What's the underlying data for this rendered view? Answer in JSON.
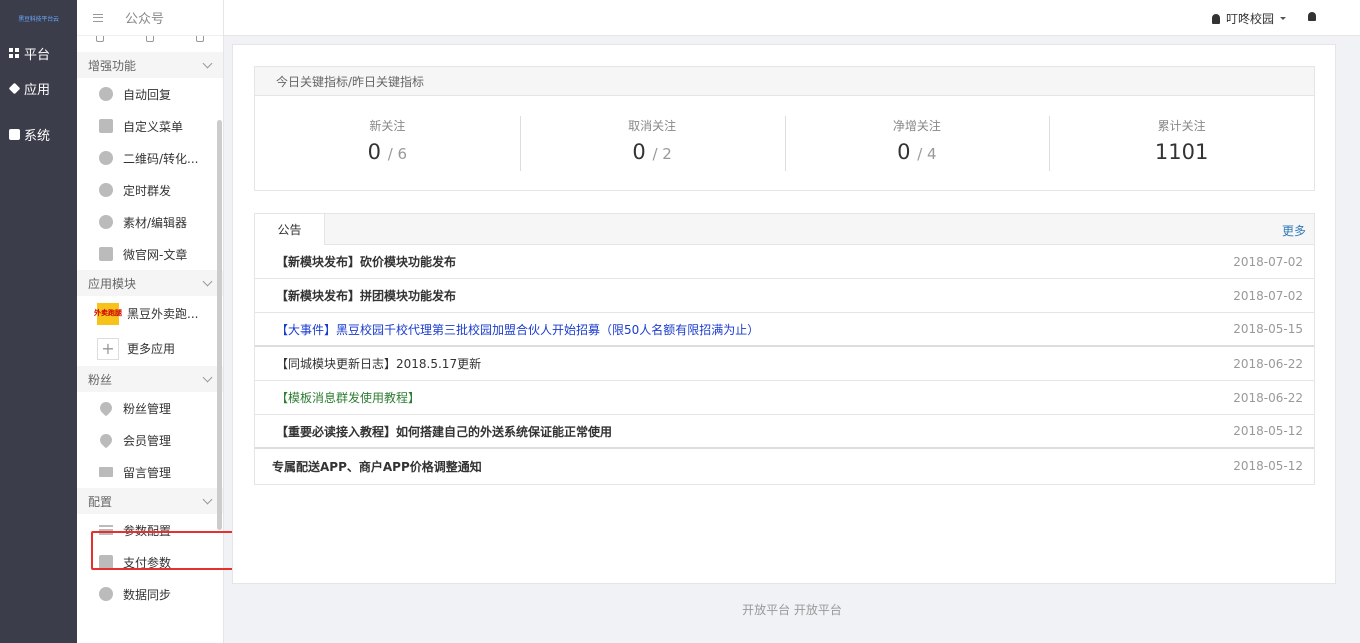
{
  "rail": {
    "logo": "黑豆科技平台云",
    "items": [
      {
        "label": "平台",
        "icon": "grid-icon"
      },
      {
        "label": "应用",
        "icon": "cube-icon"
      },
      {
        "label": "系统",
        "icon": "chat-icon"
      }
    ]
  },
  "sidebar": {
    "title": "公众号",
    "groups": {
      "enhanced": "增强功能",
      "app_modules": "应用模块",
      "fans": "粉丝",
      "config": "配置"
    },
    "enhanced_items": [
      "自动回复",
      "自定义菜单",
      "二维码/转化...",
      "定时群发",
      "素材/编辑器",
      "微官网-文章"
    ],
    "app_items": [
      "黑豆外卖跑...",
      "更多应用"
    ],
    "app_logo_text": "外卖跑腿",
    "fans_items": [
      "粉丝管理",
      "会员管理",
      "留言管理"
    ],
    "config_items": [
      "参数配置",
      "支付参数",
      "数据同步"
    ]
  },
  "header": {
    "user": "叮咚校园"
  },
  "stats": {
    "title": "今日关键指标/昨日关键指标",
    "cells": [
      {
        "label": "新关注",
        "today": "0",
        "yesterday": "/ 6"
      },
      {
        "label": "取消关注",
        "today": "0",
        "yesterday": "/ 2"
      },
      {
        "label": "净增关注",
        "today": "0",
        "yesterday": "/ 4"
      },
      {
        "label": "累计关注",
        "today": "1101",
        "yesterday": ""
      }
    ]
  },
  "notice": {
    "tab": "公告",
    "more": "更多",
    "rows": [
      {
        "title": "【新模块发布】砍价模块功能发布",
        "date": "2018-07-02"
      },
      {
        "title": "【新模块发布】拼团模块功能发布",
        "date": "2018-07-02"
      },
      {
        "title": "【大事件】黑豆校园千校代理第三批校园加盟合伙人开始招募（限50人名额有限招满为止）",
        "date": "2018-05-15"
      },
      {
        "title": "【同城模块更新日志】2018.5.17更新",
        "date": "2018-06-22"
      },
      {
        "title": "【模板消息群发使用教程】",
        "date": "2018-06-22"
      },
      {
        "title": "【重要必读接入教程】如何搭建自己的外送系统保证能正常使用",
        "date": "2018-05-12"
      },
      {
        "title": "专属配送APP、商户APP价格调整通知",
        "date": "2018-05-12"
      }
    ]
  },
  "footer": "开放平台 开放平台"
}
